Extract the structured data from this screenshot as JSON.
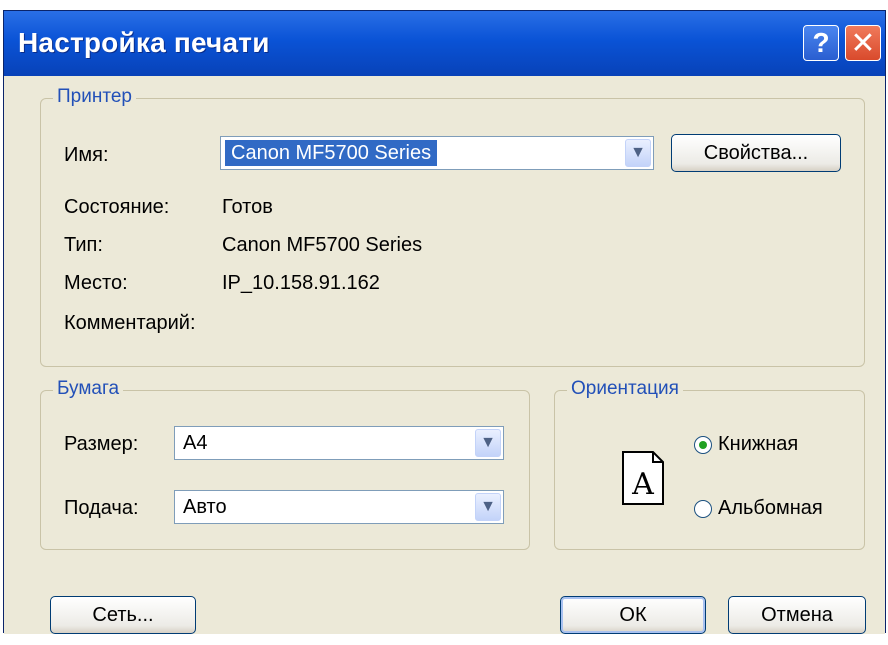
{
  "window": {
    "title": "Настройка печати"
  },
  "titlebar": {
    "help_label": "?",
    "close_label": "✕"
  },
  "printer": {
    "group_title": "Принтер",
    "name_label": "Имя:",
    "name_value": "Canon MF5700 Series",
    "properties_button": "Свойства...",
    "status_label": "Состояние:",
    "status_value": "Готов",
    "type_label": "Тип:",
    "type_value": "Canon MF5700 Series",
    "location_label": "Место:",
    "location_value": "IP_10.158.91.162",
    "comment_label": "Комментарий:",
    "comment_value": ""
  },
  "paper": {
    "group_title": "Бумага",
    "size_label": "Размер:",
    "size_value": "A4",
    "source_label": "Подача:",
    "source_value": "Авто"
  },
  "orientation": {
    "group_title": "Ориентация",
    "page_glyph": "A",
    "portrait_label": "Книжная",
    "landscape_label": "Альбомная",
    "selected": "portrait"
  },
  "footer": {
    "network_button": "Сеть...",
    "ok_button": "ОК",
    "cancel_button": "Отмена"
  },
  "colors": {
    "title_bar": "#0a53d6",
    "group_title": "#2250b8",
    "selection": "#316ac5",
    "close_button": "#d94a2c"
  }
}
